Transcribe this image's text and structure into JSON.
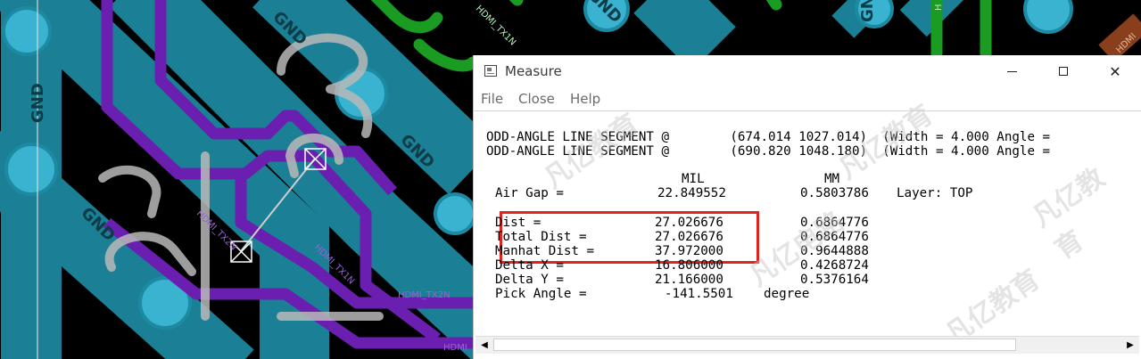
{
  "pcb": {
    "labels": [
      "GND",
      "GND",
      "GND",
      "GND",
      "GND",
      "GND",
      "HDMI_TX1N",
      "HDMI_TX2N",
      "HDMI_TX1N",
      "HDMI_TX2N",
      "HDMI",
      "H",
      "HDMI",
      "HDMI"
    ],
    "colors": {
      "background": "#000000",
      "gnd_trace": "#1b7f95",
      "via": "#3ab3d0",
      "signal_trace": "#6a1fb0",
      "green_trace": "#1a9c23",
      "silkscreen": "#b9b9b9",
      "brown_trace": "#8a3f1c"
    }
  },
  "window": {
    "title": "Measure",
    "menu": [
      "File",
      "Close",
      "Help"
    ],
    "segment_lines": [
      "ODD-ANGLE LINE SEGMENT @        (674.014 1027.014)  (Width = 4.000 Angle =",
      "ODD-ANGLE LINE SEGMENT @        (690.820 1048.180)  (Width = 4.000 Angle ="
    ],
    "header": {
      "mil": "MIL",
      "mm": "MM"
    },
    "airgap": {
      "label": "Air Gap =",
      "mil": "22.849552",
      "mm": "0.5803786",
      "layer": "Layer: TOP"
    },
    "rows": [
      {
        "label": "Dist =",
        "mil": "27.026676",
        "mm": "0.6864776"
      },
      {
        "label": "Total Dist =",
        "mil": "27.026676",
        "mm": "0.6864776"
      },
      {
        "label": "Manhat Dist =",
        "mil": "37.972000",
        "mm": "0.9644888"
      },
      {
        "label": "Delta X =",
        "mil": "16.806000",
        "mm": "0.4268724"
      },
      {
        "label": "Delta Y =",
        "mil": "21.166000",
        "mm": "0.5376164"
      }
    ],
    "pick_angle": {
      "label": "Pick Angle =",
      "value": "-141.5501",
      "unit": "degree"
    },
    "watermarks": [
      "凡亿教育",
      "凡亿教育",
      "凡亿电路",
      "凡亿教育",
      "凡亿教育"
    ],
    "highlight_color": "#e1221e"
  }
}
